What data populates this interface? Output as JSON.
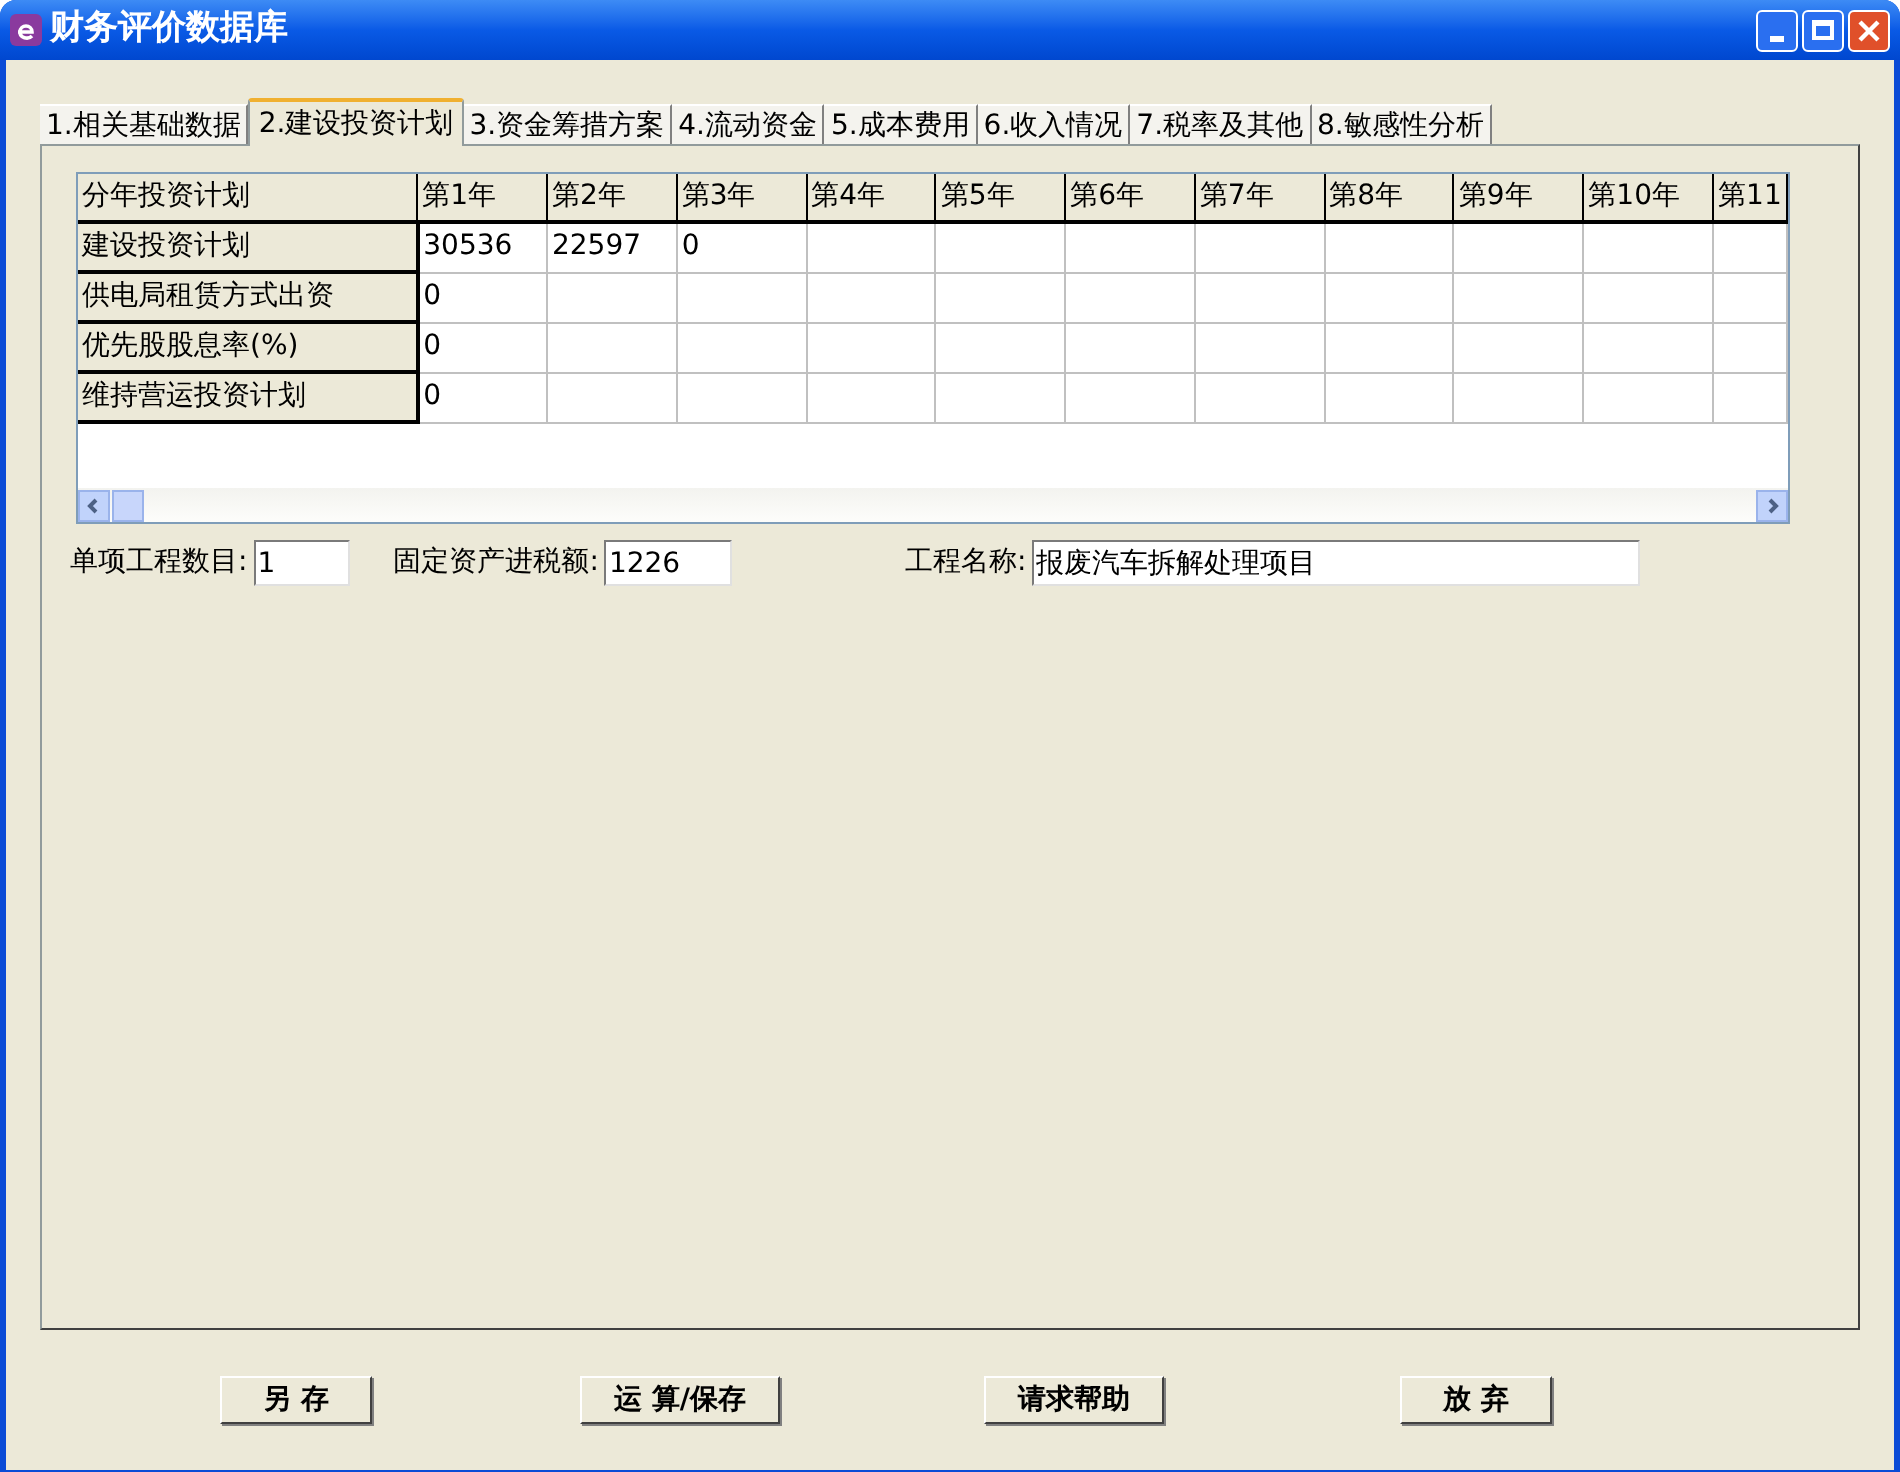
{
  "window": {
    "title": "财务评价数据库"
  },
  "tabs": [
    {
      "label": "1.相关基础数据",
      "selected": false
    },
    {
      "label": "2.建设投资计划",
      "selected": true
    },
    {
      "label": "3.资金筹措方案",
      "selected": false
    },
    {
      "label": "4.流动资金",
      "selected": false
    },
    {
      "label": "5.成本费用",
      "selected": false
    },
    {
      "label": "6.收入情况",
      "selected": false
    },
    {
      "label": "7.税率及其他",
      "selected": false
    },
    {
      "label": "8.敏感性分析",
      "selected": false
    }
  ],
  "table": {
    "corner": "分年投资计划",
    "columns": [
      "第1年",
      "第2年",
      "第3年",
      "第4年",
      "第5年",
      "第6年",
      "第7年",
      "第8年",
      "第9年",
      "第10年",
      "第11"
    ],
    "rows": [
      {
        "label": "建设投资计划",
        "cells": [
          "30536",
          "22597",
          "0"
        ]
      },
      {
        "label": "供电局租赁方式出资",
        "cells": [
          "0"
        ]
      },
      {
        "label": "优先股股息率(%)",
        "cells": [
          "0"
        ]
      },
      {
        "label": "维持营运投资计划",
        "cells": [
          "0"
        ]
      }
    ]
  },
  "fields": [
    {
      "label": "单项工程数目:",
      "value": "1"
    },
    {
      "label": "固定资产进税额:",
      "value": "1226"
    },
    {
      "label": "工程名称:",
      "value": "报废汽车拆解处理项目"
    }
  ],
  "buttons": [
    "另 存",
    "运 算/保存",
    "请求帮助",
    "放 弃"
  ]
}
